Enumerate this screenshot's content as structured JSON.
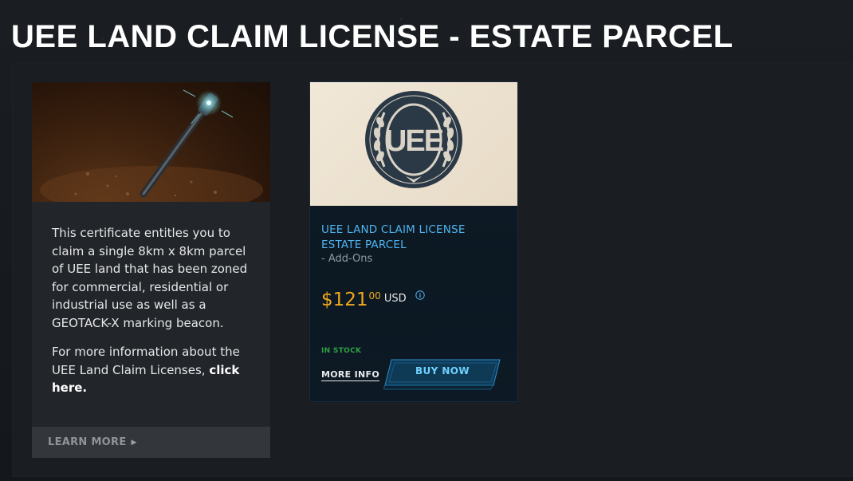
{
  "page": {
    "title": "UEE LAND CLAIM LICENSE - ESTATE PARCEL"
  },
  "info_card": {
    "description": "This certificate entitles you to claim a single 8km x 8km parcel of UEE land that has been zoned for commercial, residential or industrial use as well as a GEOTACK-X marking beacon.",
    "more_info_prefix": "For more information about the UEE Land Claim Licenses, ",
    "more_info_link": "click here.",
    "learn_more_label": "LEARN MORE"
  },
  "product": {
    "name_line1": "UEE LAND CLAIM LICENSE",
    "name_line2": "ESTATE PARCEL",
    "category": "- Add-Ons",
    "price_main": "$121",
    "price_cents": "00",
    "currency": "USD",
    "stock_status": "IN STOCK",
    "more_info_label": "MORE INFO",
    "buy_now_label": "BUY NOW",
    "logo_text": "UEE"
  },
  "colors": {
    "accent_blue": "#4fb4f0",
    "price_orange": "#f1a91d",
    "in_stock_green": "#2ea043"
  },
  "icons": {
    "info": "info-circle-icon",
    "chevron": "chevron-right-icon"
  }
}
